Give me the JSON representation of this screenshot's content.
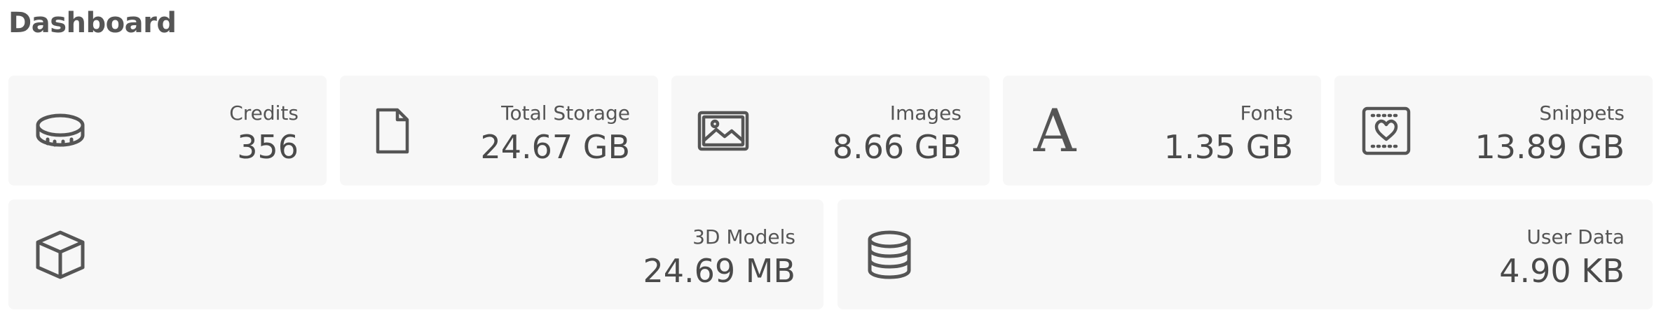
{
  "header": {
    "title": "Dashboard"
  },
  "cards": [
    {
      "label": "Credits",
      "value": "356",
      "icon": "coin-icon"
    },
    {
      "label": "Total Storage",
      "value": "24.67 GB",
      "icon": "file-icon"
    },
    {
      "label": "Images",
      "value": "8.66 GB",
      "icon": "image-icon"
    },
    {
      "label": "Fonts",
      "value": "1.35 GB",
      "icon": "font-icon",
      "glyph": "A"
    },
    {
      "label": "Snippets",
      "value": "13.89 GB",
      "icon": "snippet-heart-icon"
    },
    {
      "label": "3D Models",
      "value": "24.69 MB",
      "icon": "cube-icon"
    },
    {
      "label": "User Data",
      "value": "4.90 KB",
      "icon": "database-icon"
    }
  ],
  "colors": {
    "card_bg": "#f7f7f7",
    "text": "#4a4a4a",
    "icon": "#555555"
  }
}
